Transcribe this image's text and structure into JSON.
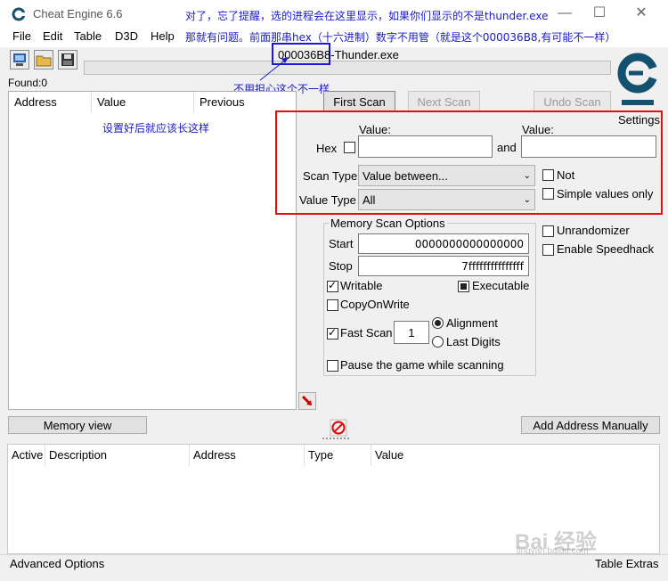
{
  "window": {
    "title": "Cheat Engine 6.6",
    "minimize": "—",
    "maximize": "☐",
    "close": "✕"
  },
  "menu": [
    "File",
    "Edit",
    "Table",
    "D3D",
    "Help"
  ],
  "annotations": {
    "top_line1": "对了，忘了提醒，选的进程会在这里显示，如果你们显示的不是thunder.exe",
    "top_line2": "那就有问题。前面那串hex（十六进制）数字不用管（就是这个000036B8,有可能不一样）",
    "pid_note": "不用担心这个不一样",
    "settings_note": "设置好后就应该长这样"
  },
  "process": {
    "pid": "000036B8",
    "name": "-Thunder.exe"
  },
  "found": "Found:0",
  "results_columns": [
    "Address",
    "Value",
    "Previous"
  ],
  "scan_buttons": {
    "first": "First Scan",
    "next": "Next Scan",
    "undo": "Undo Scan",
    "settings": "Settings"
  },
  "scan": {
    "value_label_1": "Value:",
    "value_label_2": "Value:",
    "hex_label": "Hex",
    "and_label": "and",
    "scan_type_label": "Scan Type",
    "scan_type_value": "Value between...",
    "value_type_label": "Value Type",
    "value_type_value": "All",
    "not_label": "Not",
    "simple_values_label": "Simple values only"
  },
  "memory_options": {
    "title": "Memory Scan Options",
    "start_label": "Start",
    "start_value": "0000000000000000",
    "stop_label": "Stop",
    "stop_value": "7fffffffffffffff",
    "writable": "Writable",
    "executable": "Executable",
    "copy_on_write": "CopyOnWrite",
    "fast_scan": "Fast Scan",
    "fast_scan_value": "1",
    "alignment": "Alignment",
    "last_digits": "Last Digits",
    "pause_game": "Pause the game while scanning"
  },
  "right_options": {
    "unrandomizer": "Unrandomizer",
    "speedhack": "Enable Speedhack"
  },
  "buttons": {
    "memory_view": "Memory view",
    "add_address": "Add Address Manually"
  },
  "table_columns": [
    "Active",
    "Description",
    "Address",
    "Type",
    "Value"
  ],
  "status": {
    "advanced": "Advanced Options",
    "extras": "Table Extras"
  },
  "watermark": {
    "brand": "Bai 经验",
    "url": "jingyan.baidu.com"
  },
  "colors": {
    "annotation_blue": "#1a1acc",
    "highlight_red": "#e01010"
  }
}
